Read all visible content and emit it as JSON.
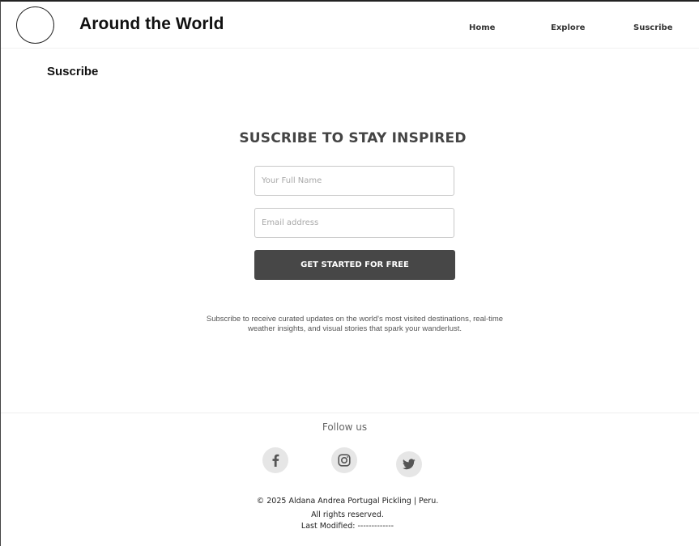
{
  "header": {
    "site_title": "Around the World",
    "nav": [
      {
        "label": "Home"
      },
      {
        "label": "Explore"
      },
      {
        "label": "Suscribe"
      }
    ]
  },
  "page": {
    "heading": "Suscribe"
  },
  "form": {
    "title": "SUSCRIBE TO STAY INSPIRED",
    "name_placeholder": "Your Full Name",
    "email_placeholder": "Email address",
    "name_value": "",
    "email_value": "",
    "submit_label": "GET STARTED FOR FREE",
    "blurb": "Subscribe to receive curated updates on the world's most visited destinations, real-time weather insights, and visual stories that spark your wanderlust."
  },
  "footer": {
    "follow_label": "Follow us",
    "social": [
      {
        "icon": "facebook-icon"
      },
      {
        "icon": "instagram-icon"
      },
      {
        "icon": "twitter-icon"
      }
    ],
    "copyright": "© 2025 Aldana Andrea Portugal Pickling | Peru.  All rights reserved.",
    "last_modified": "Last Modified: -------------"
  },
  "colors": {
    "button_bg": "#474747",
    "social_bg": "#e6e6e6",
    "social_icon": "#555555"
  }
}
